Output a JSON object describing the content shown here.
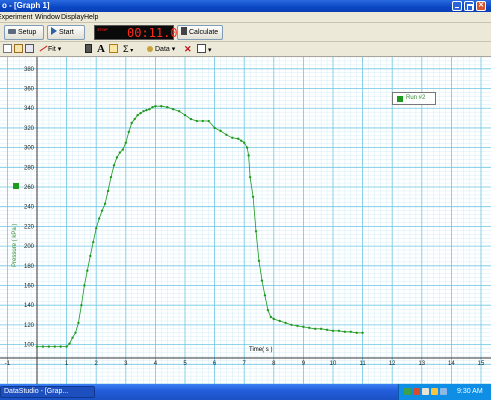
{
  "window": {
    "title": "o - [Graph 1]"
  },
  "menu": [
    "Experiment",
    "Window",
    "Display",
    "Help"
  ],
  "toolbar": {
    "setup_label": "Setup",
    "start_label": "Start",
    "timer_status": "STOP",
    "timer_value": "00:11.0",
    "calculate_label": "Calculate"
  },
  "graph_toolbar": {
    "fit_label": "Fit",
    "data_label": "Data",
    "sigma_label": "Σ",
    "a_label": "A"
  },
  "legend": {
    "run_label": "Run #2",
    "color": "#1e9a1e"
  },
  "taskbar": {
    "task_label": "DataStudio - [Grap...",
    "clock": "9:30 AM"
  },
  "chart_data": {
    "type": "scatter",
    "title": "",
    "xlabel": "Time( s )",
    "ylabel": "Pressure ( kPa )",
    "xlim": [
      -1,
      15
    ],
    "ylim": [
      60,
      392
    ],
    "x_ticks": [
      -1,
      1,
      2,
      3,
      4,
      5,
      6,
      7,
      8,
      9,
      10,
      11,
      12,
      13,
      14,
      15
    ],
    "y_ticks": [
      100,
      120,
      140,
      160,
      180,
      200,
      220,
      240,
      260,
      280,
      300,
      320,
      340,
      360,
      380
    ],
    "grid": true,
    "legend_position": "top-right",
    "series": [
      {
        "name": "Run #2",
        "color": "#1e9a1e",
        "x": [
          0.0,
          0.2,
          0.4,
          0.6,
          0.8,
          1.0,
          1.1,
          1.2,
          1.3,
          1.4,
          1.5,
          1.6,
          1.7,
          1.8,
          1.9,
          2.0,
          2.1,
          2.2,
          2.3,
          2.4,
          2.5,
          2.6,
          2.7,
          2.8,
          2.9,
          3.0,
          3.1,
          3.2,
          3.3,
          3.4,
          3.5,
          3.6,
          3.7,
          3.8,
          3.9,
          4.0,
          4.2,
          4.4,
          4.6,
          4.8,
          5.0,
          5.2,
          5.4,
          5.6,
          5.8,
          6.0,
          6.2,
          6.4,
          6.6,
          6.8,
          6.9,
          7.0,
          7.1,
          7.15,
          7.2,
          7.3,
          7.4,
          7.5,
          7.6,
          7.7,
          7.8,
          7.9,
          8.0,
          8.2,
          8.4,
          8.6,
          8.8,
          9.0,
          9.2,
          9.4,
          9.6,
          9.8,
          10.0,
          10.2,
          10.4,
          10.6,
          10.8,
          11.0
        ],
        "y": [
          98,
          98,
          98,
          98,
          98,
          98,
          101,
          107,
          112,
          122,
          140,
          160,
          175,
          190,
          204,
          218,
          228,
          236,
          243,
          256,
          270,
          282,
          290,
          295,
          298,
          305,
          316,
          325,
          329,
          333,
          335,
          337,
          338,
          339,
          341,
          342,
          342,
          341,
          339,
          337,
          333,
          329,
          327,
          327,
          327,
          320,
          317,
          313,
          310,
          309,
          307,
          305,
          300,
          292,
          270,
          250,
          215,
          185,
          165,
          150,
          135,
          128,
          126,
          124,
          122,
          120,
          119,
          118,
          117,
          116,
          116,
          115,
          114,
          114,
          113,
          113,
          112,
          112
        ]
      }
    ]
  }
}
